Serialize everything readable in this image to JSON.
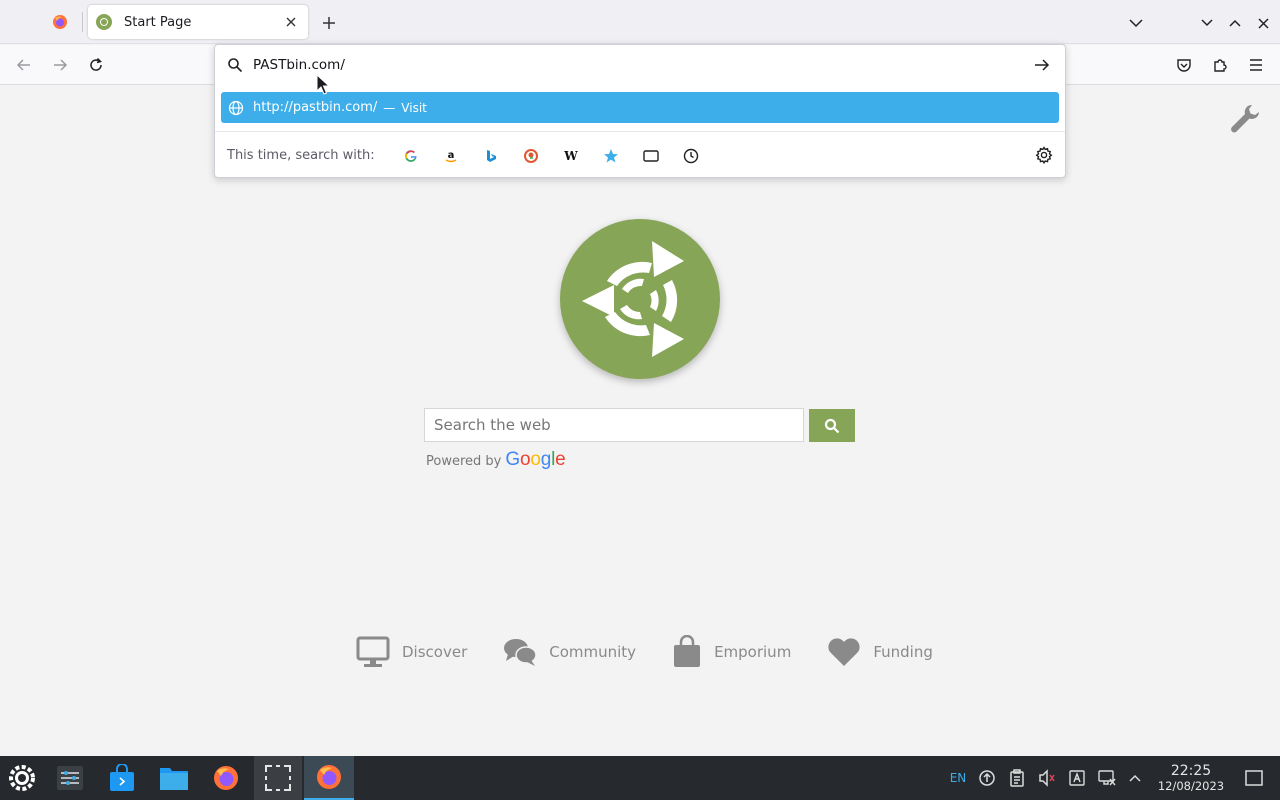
{
  "tabs": [
    {
      "title": "Start Page"
    }
  ],
  "urlbar": {
    "typed_text": "PASTbin.com/",
    "result_url": "http://pastbin.com/",
    "result_sep": "—",
    "result_action": "Visit",
    "oneoff_label": "This time, search with:",
    "engines": [
      "google-icon",
      "amazon-icon",
      "bing-icon",
      "duckduckgo-icon",
      "wikipedia-icon",
      "bookmarks-icon",
      "tabs-icon",
      "history-icon"
    ]
  },
  "page": {
    "search_placeholder": "Search the web",
    "powered_by": "Powered by",
    "google_word": "Google",
    "footer_links": [
      {
        "label": "Discover",
        "icon": "monitor-icon"
      },
      {
        "label": "Community",
        "icon": "chat-bubbles-icon"
      },
      {
        "label": "Emporium",
        "icon": "shopping-bag-icon"
      },
      {
        "label": "Funding",
        "icon": "heart-icon"
      }
    ],
    "brand_color": "#87a556"
  },
  "taskbar": {
    "keyboard_layout": "EN",
    "time": "22:25",
    "date": "12/08/2023",
    "accent": "#3daee9"
  }
}
